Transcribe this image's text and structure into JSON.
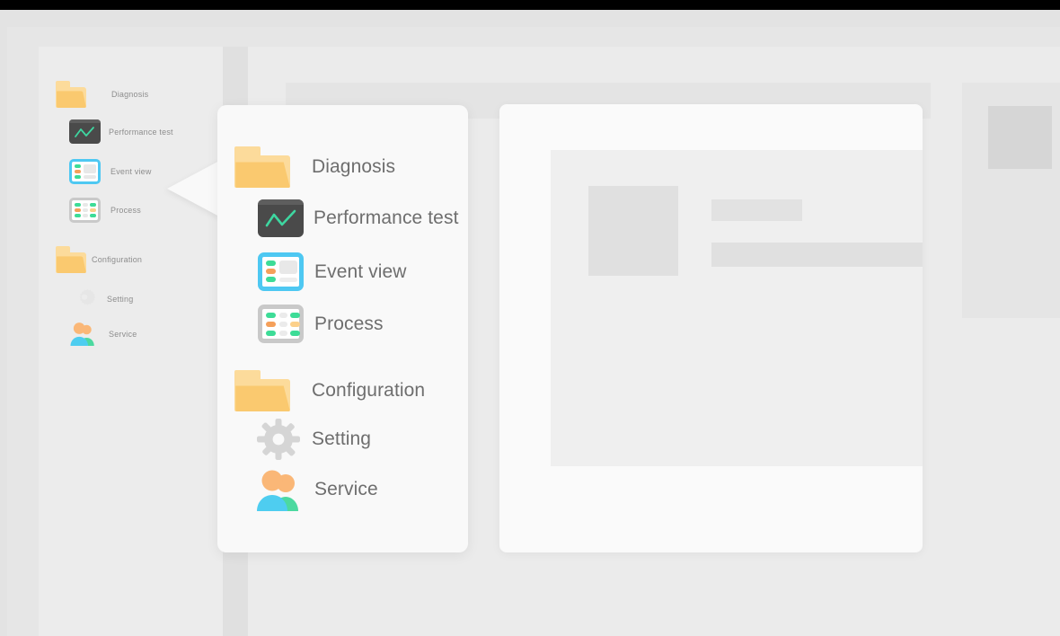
{
  "window": {
    "topbar_color": "#000000",
    "page_background": "#e6e6e6"
  },
  "sidebar": {
    "name": "navigation-sidebar",
    "background": "#ececec",
    "items": [
      {
        "label": "Diagnosis",
        "icon": "folder-icon",
        "level": "group"
      },
      {
        "label": "Performance test",
        "icon": "performance-test-icon",
        "level": "child"
      },
      {
        "label": "Event view",
        "icon": "event-view-icon",
        "level": "child"
      },
      {
        "label": "Process",
        "icon": "process-icon",
        "level": "child"
      },
      {
        "label": "Configuration",
        "icon": "folder-icon",
        "level": "group"
      },
      {
        "label": "Setting",
        "icon": "gear-icon",
        "level": "child"
      },
      {
        "label": "Service",
        "icon": "service-people-icon",
        "level": "child"
      }
    ]
  },
  "popup": {
    "name": "magnified-menu-callout",
    "background": "#f9f9f9",
    "items": [
      {
        "label": "Diagnosis",
        "icon": "folder-icon",
        "level": "group"
      },
      {
        "label": "Performance test",
        "icon": "performance-test-icon",
        "level": "child"
      },
      {
        "label": "Event view",
        "icon": "event-view-icon",
        "level": "child"
      },
      {
        "label": "Process",
        "icon": "process-icon",
        "level": "child"
      },
      {
        "label": "Configuration",
        "icon": "folder-icon",
        "level": "group"
      },
      {
        "label": "Setting",
        "icon": "gear-icon",
        "level": "child"
      },
      {
        "label": "Service",
        "icon": "service-people-icon",
        "level": "child"
      }
    ]
  },
  "colors": {
    "folder_back": "#fcdb9b",
    "folder_front": "#fac96f",
    "chart_dark": "#4a4a4a",
    "chart_line": "#3ed6a0",
    "accent_blue": "#4ec8f2",
    "accent_green": "#3ddc97",
    "accent_orange": "#f5a05a",
    "accent_yellow": "#fcd08a",
    "gear_gray": "#d5d5d5",
    "person_head": "#fab777",
    "person_body_front": "#4ecdf0",
    "person_body_back": "#4cd9a0",
    "label_small": "#8d8d8d",
    "label_large": "#6e6e6e"
  },
  "placeholders": {
    "content_header": "",
    "card_thumbnail": "",
    "card_text_line_short": "",
    "card_text_line_long": "",
    "right_panel_box": ""
  }
}
